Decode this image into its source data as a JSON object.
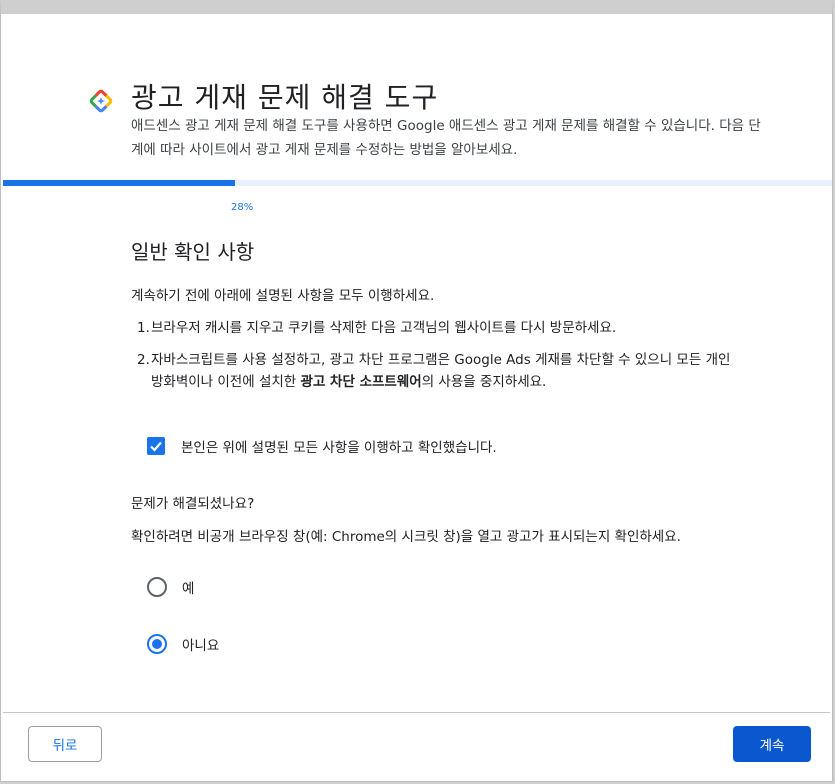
{
  "header": {
    "icon": "adsense-diamond-icon",
    "title": "광고 게재 문제 해결 도구",
    "description": "애드센스 광고 게재 문제 해결 도구를 사용하면 Google 애드센스 광고 게재 문제를 해결할 수 있습니다. 다음 단계에 따라 사이트에서 광고 게재 문제를 수정하는 방법을 알아보세요."
  },
  "progress": {
    "value_percent": 28,
    "label": "28%"
  },
  "section": {
    "title": "일반 확인 사항",
    "intro": "계속하기 전에 아래에 설명된 사항을 모두 이행하세요.",
    "steps": [
      {
        "num": "1.",
        "text": "브라우저 캐시를 지우고 쿠키를 삭제한 다음 고객님의 웹사이트를 다시 방문하세요."
      },
      {
        "num": "2.",
        "text_before": "자바스크립트를 사용 설정하고, 광고 차단 프로그램은 Google Ads 게재를 차단할 수 있으니 모든 개인 방화벽이나 이전에 설치한 ",
        "text_bold": "광고 차단 소프트웨어",
        "text_after": "의 사용을 중지하세요."
      }
    ],
    "confirm_checkbox": {
      "checked": true,
      "label": "본인은 위에 설명된 모든 사항을 이행하고 확인했습니다."
    }
  },
  "question": {
    "title": "문제가 해결되셨나요?",
    "help": "확인하려면 비공개 브라우징 창(예: Chrome의 시크릿 창)을 열고 광고가 표시되는지 확인하세요.",
    "options": [
      {
        "label": "예",
        "selected": false
      },
      {
        "label": "아니요",
        "selected": true
      }
    ]
  },
  "footer": {
    "back_label": "뒤로",
    "next_label": "계속"
  },
  "colors": {
    "accent": "#1a73e8",
    "primary_button": "#0b57d0",
    "progress_track": "#e8f0fe"
  }
}
